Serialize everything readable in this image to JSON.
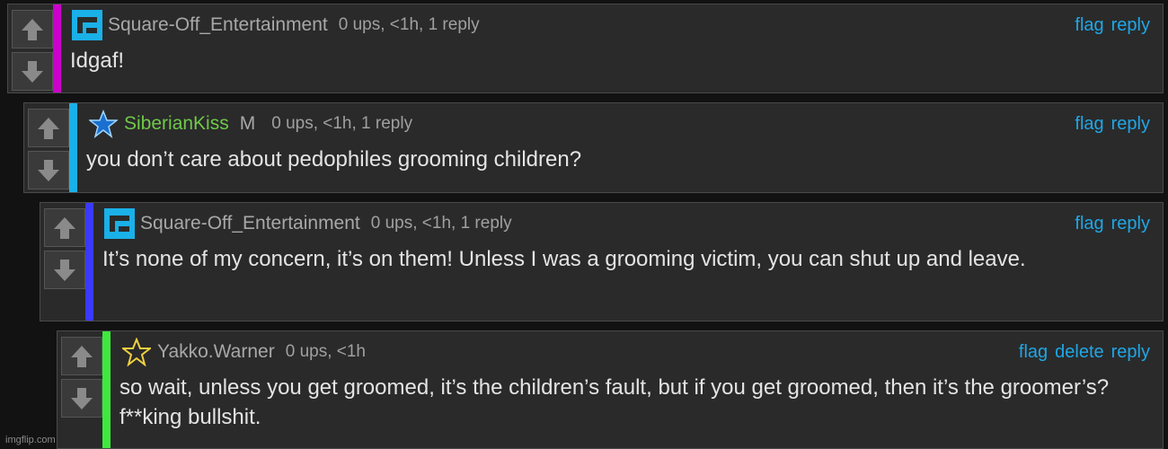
{
  "colors": {
    "accent_1": "#cc00cc",
    "accent_2": "#1ab0e8",
    "accent_3": "#3a3aff",
    "accent_4": "#3ee83e",
    "link": "#1fa7e6"
  },
  "comments": [
    {
      "username": "Square-Off_Entertainment",
      "badge": "",
      "meta": "0 ups, <1h, 1 reply",
      "text": "Idgaf!",
      "actions": [
        "flag",
        "reply"
      ],
      "avatar": "square-off-logo-icon",
      "accent": "#cc00cc"
    },
    {
      "username": "SiberianKiss",
      "badge": "M",
      "meta": "0 ups, <1h, 1 reply",
      "text": "you don’t care about pedophiles grooming children?",
      "actions": [
        "flag",
        "reply"
      ],
      "avatar": "blue-star-icon",
      "accent": "#1ab0e8"
    },
    {
      "username": "Square-Off_Entertainment",
      "badge": "",
      "meta": "0 ups, <1h, 1 reply",
      "text": "It’s none of my concern, it’s on them! Unless I was a grooming victim, you can shut up and leave.",
      "actions": [
        "flag",
        "reply"
      ],
      "avatar": "square-off-logo-icon",
      "accent": "#3a3aff"
    },
    {
      "username": "Yakko.Warner",
      "badge": "",
      "meta": "0 ups, <1h",
      "text": "so wait, unless you get groomed, it’s the children’s fault, but if you get groomed, then it’s the groomer’s? f**king bullshit.",
      "actions": [
        "flag",
        "delete",
        "reply"
      ],
      "avatar": "yellow-star-icon",
      "accent": "#3ee83e"
    }
  ],
  "watermark": "imgflip.com"
}
